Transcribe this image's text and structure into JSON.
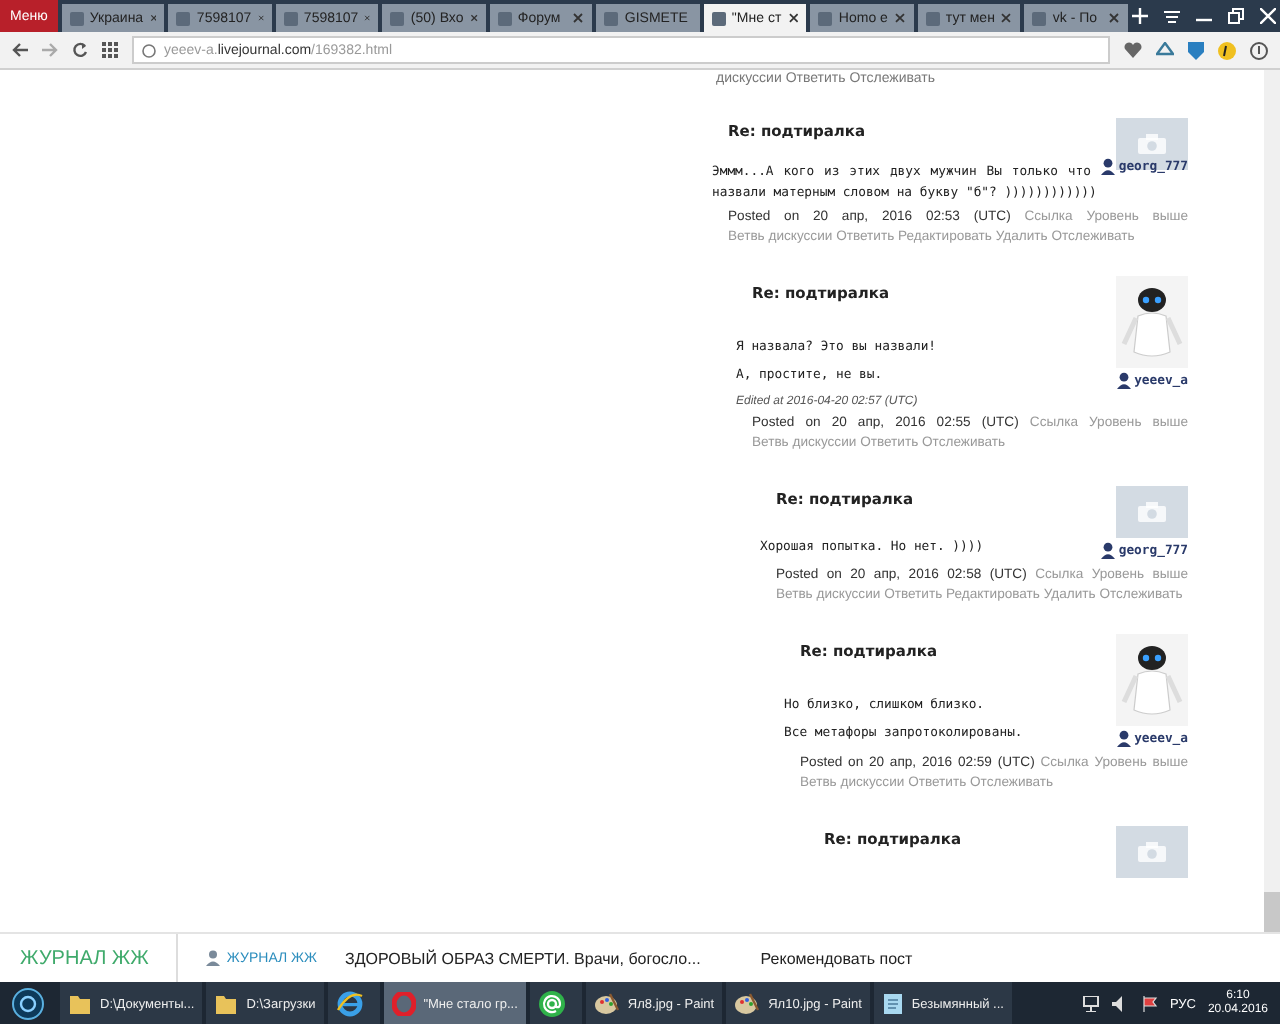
{
  "browser": {
    "menu_label": "Меню",
    "tabs": [
      {
        "title": "Украина",
        "selected": false
      },
      {
        "title": "7598107",
        "selected": false
      },
      {
        "title": "7598107",
        "selected": false
      },
      {
        "title": "(50) Вхо",
        "selected": false
      },
      {
        "title": "Форум",
        "selected": false
      },
      {
        "title": "GISMETE",
        "selected": false
      },
      {
        "title": "\"Мне ст",
        "selected": true
      },
      {
        "title": "Homo e",
        "selected": false
      },
      {
        "title": "тут мен",
        "selected": false
      },
      {
        "title": "vk - По",
        "selected": false
      }
    ],
    "address": {
      "host_prefix": "yeeev-a.",
      "host_domain": "livejournal.com",
      "path": "/169382.html"
    }
  },
  "page": {
    "top_fragment": "дискуссии Ответить Отслеживать",
    "comments": [
      {
        "title": "Re: подтиралка",
        "avatar": {
          "kind": "camera"
        },
        "paragraphs": [
          [
            {
              "kind": "text",
              "text": "Эммм...А кого из этих двух мужчин Вы только что "
            },
            {
              "kind": "user",
              "text": "georg_777"
            },
            {
              "kind": "text",
              "text": " назвали матерным словом на букву \"б\"? ))))))))))))"
            }
          ]
        ],
        "posted": "Posted on 20 апр, 2016 02:53 (UTC)",
        "links": [
          "Ссылка",
          "Уровень выше",
          "Ветвь дискуссии",
          "Ответить",
          "Редактировать",
          "Удалить",
          "Отслеживать"
        ],
        "children": [
          {
            "title": "Re: подтиралка",
            "avatar": {
              "kind": "robot"
            },
            "author": "yeeev_a",
            "paragraphs": [
              [
                {
                  "kind": "text",
                  "text": "Я назвала? Это вы назвали!"
                }
              ],
              [
                {
                  "kind": "text",
                  "text": "А, простите, не вы."
                }
              ]
            ],
            "edited": "Edited at 2016-04-20 02:57 (UTC)",
            "posted": "Posted on 20 апр, 2016 02:55 (UTC)",
            "links": [
              "Ссылка",
              "Уровень выше",
              "Ветвь дискуссии",
              "Ответить",
              "Отслеживать"
            ],
            "children": [
              {
                "title": "Re: подтиралка",
                "avatar": {
                  "kind": "camera"
                },
                "author": "georg_777",
                "paragraphs": [
                  [
                    {
                      "kind": "text",
                      "text": "Хорошая попытка. Но нет. ))))"
                    }
                  ]
                ],
                "posted": "Posted on 20 апр, 2016 02:58 (UTC)",
                "links": [
                  "Ссылка",
                  "Уровень выше",
                  "Ветвь дискуссии",
                  "Ответить",
                  "Редактировать",
                  "Удалить",
                  "Отслеживать"
                ],
                "children": [
                  {
                    "title": "Re: подтиралка",
                    "avatar": {
                      "kind": "robot"
                    },
                    "author": "yeeev_a",
                    "paragraphs": [
                      [
                        {
                          "kind": "text",
                          "text": "Но близко, слишком близко."
                        }
                      ],
                      [
                        {
                          "kind": "text",
                          "text": "Все метафоры запротоколированы."
                        }
                      ]
                    ],
                    "posted": "Posted on 20 апр, 2016 02:59 (UTC)",
                    "links": [
                      "Ссылка",
                      "Уровень выше",
                      "Ветвь дискуссии",
                      "Ответить",
                      "Отслеживать"
                    ],
                    "children": [
                      {
                        "title": "Re: подтиралка",
                        "avatar": {
                          "kind": "camera"
                        }
                      }
                    ]
                  }
                ]
              }
            ]
          }
        ]
      }
    ]
  },
  "lj_bar": {
    "logo": "ЖУРНАЛ ЖЖ",
    "journal_link": "ЖУРНАЛ ЖЖ",
    "headline": "ЗДОРОВЫЙ ОБРАЗ СМЕРТИ. Врачи, богосло...",
    "recommend": "Рекомендовать пост"
  },
  "taskbar": {
    "items": [
      {
        "kind": "folder",
        "label": "D:\\Документы...",
        "selected": false
      },
      {
        "kind": "folder",
        "label": "D:\\Загрузки",
        "selected": false
      },
      {
        "kind": "ie",
        "selected": false
      },
      {
        "kind": "opera",
        "label": "\"Мне стало гр...",
        "selected": true
      },
      {
        "kind": "mail",
        "selected": false
      },
      {
        "kind": "paint",
        "label": "Ял8.jpg - Paint",
        "selected": false
      },
      {
        "kind": "paint",
        "label": "Ял10.jpg - Paint",
        "selected": false
      },
      {
        "kind": "doc",
        "label": "Безымянный ...",
        "selected": false
      }
    ],
    "language": "РУС",
    "time": "6:10",
    "date": "20.04.2016"
  }
}
